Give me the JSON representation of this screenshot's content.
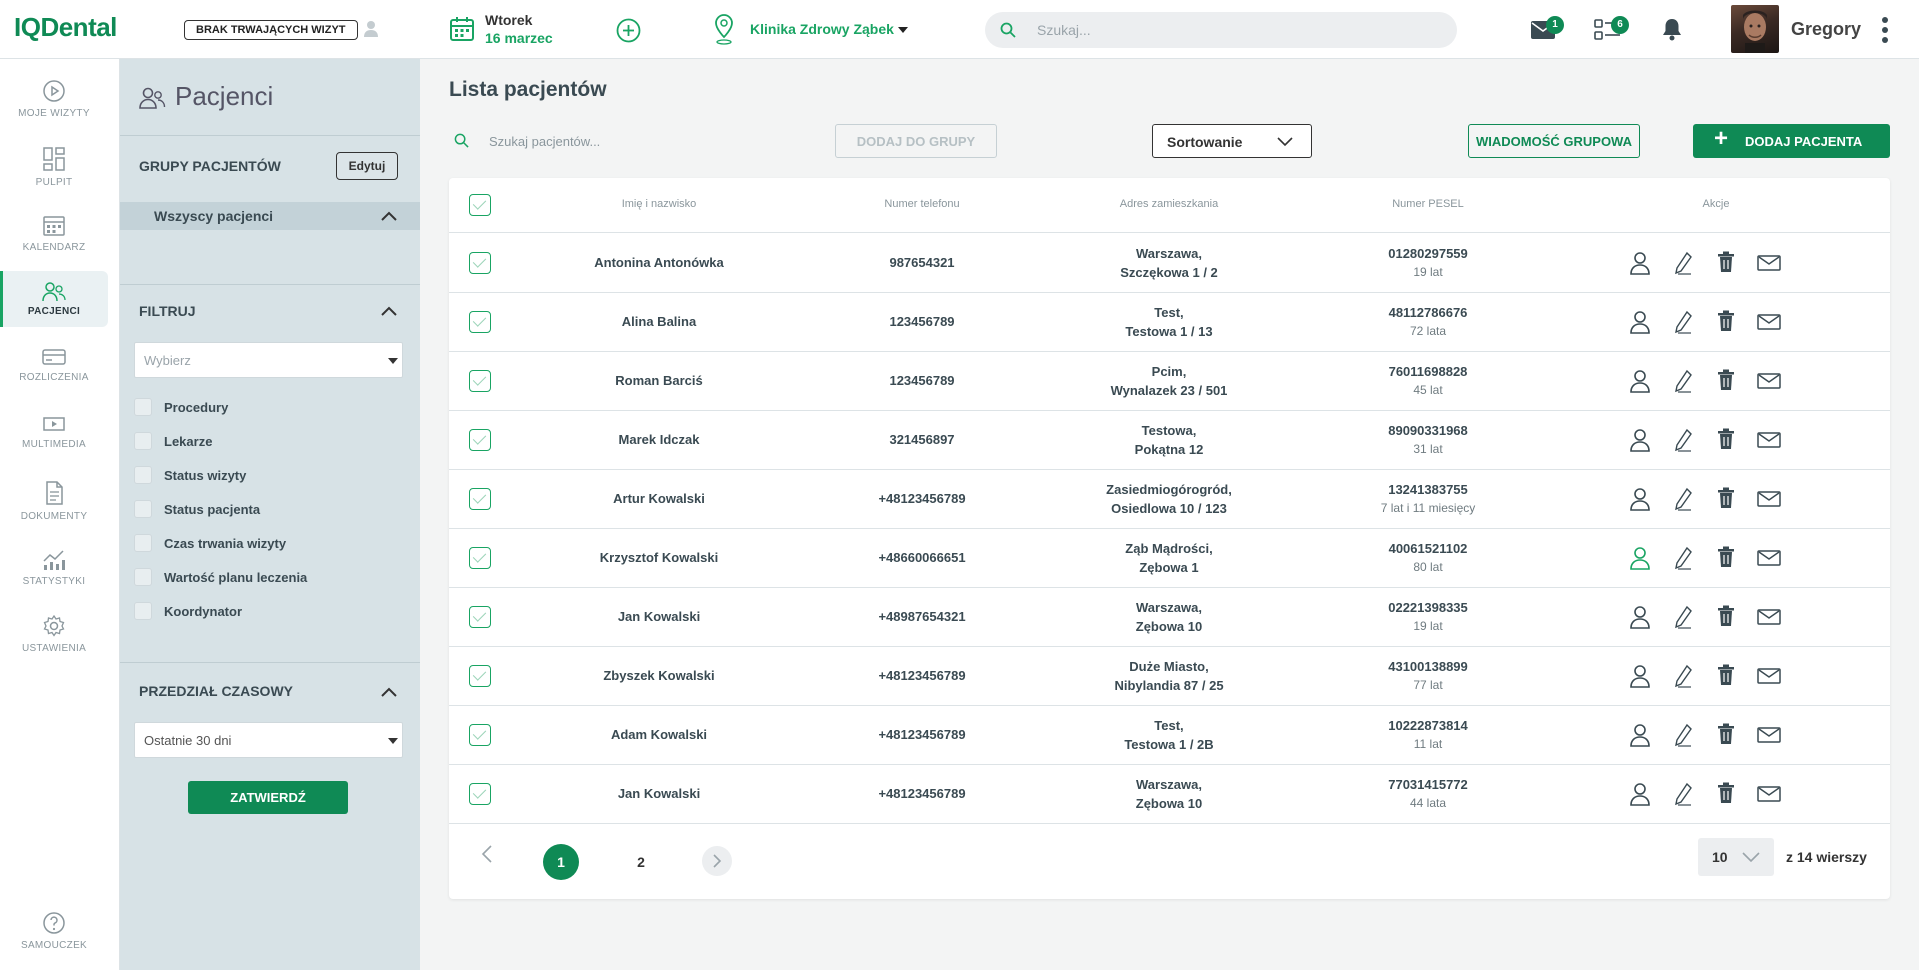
{
  "topbar": {
    "logo": "IQDental",
    "no_visits": "BRAK TRWAJĄCYCH WIZYT",
    "date_day": "Wtorek",
    "date_value": "16 marzec",
    "clinic": "Klinika Zdrowy Ząbek",
    "search_placeholder": "Szukaj...",
    "mail_count": "1",
    "tasks_count": "6",
    "user_name": "Gregory"
  },
  "nav": {
    "items": [
      {
        "label": "MOJE WIZYTY",
        "icon": "play-circle-icon"
      },
      {
        "label": "PULPIT",
        "icon": "dashboard-icon"
      },
      {
        "label": "KALENDARZ",
        "icon": "calendar-icon"
      },
      {
        "label": "PACJENCI",
        "icon": "patients-icon",
        "active": true
      },
      {
        "label": "ROZLICZENIA",
        "icon": "billing-icon"
      },
      {
        "label": "MULTIMEDIA",
        "icon": "multimedia-icon"
      },
      {
        "label": "DOKUMENTY",
        "icon": "documents-icon"
      },
      {
        "label": "STATYSTYKI",
        "icon": "statistics-icon"
      },
      {
        "label": "USTAWIENIA",
        "icon": "settings-icon"
      }
    ],
    "help_label": "SAMOUCZEK"
  },
  "panel": {
    "title": "Pacjenci",
    "groups_title": "GRUPY PACJENTÓW",
    "edit_label": "Edytuj",
    "all_patients": "Wszyscy pacjenci",
    "filter_title": "FILTRUJ",
    "filter_select": "Wybierz",
    "filters": [
      "Procedury",
      "Lekarze",
      "Status wizyty",
      "Status pacjenta",
      "Czas trwania wizyty",
      "Wartość planu leczenia",
      "Koordynator"
    ],
    "time_title": "PRZEDZIAŁ CZASOWY",
    "time_select": "Ostatnie 30 dni",
    "confirm_label": "ZATWIERDŹ"
  },
  "main": {
    "title": "Lista pacjentów",
    "search_placeholder": "Szukaj pacjentów...",
    "add_to_group": "DODAJ DO GRUPY",
    "sort_label": "Sortowanie",
    "group_message": "WIADOMOŚĆ GRUPOWA",
    "add_patient": "DODAJ PACJENTA"
  },
  "table": {
    "columns": [
      "Imię i nazwisko",
      "Numer telefonu",
      "Adres zamieszkania",
      "Numer PESEL",
      "Akcje"
    ],
    "rows": [
      {
        "name": "Antonina Antonówka",
        "phone": "987654321",
        "city": "Warszawa,",
        "street": "Szczękowa 1 / 2",
        "pesel": "01280297559",
        "age": "19 lat"
      },
      {
        "name": "Alina Balina",
        "phone": "123456789",
        "city": "Test,",
        "street": "Testowa 1 / 13",
        "pesel": "48112786676",
        "age": "72 lata"
      },
      {
        "name": "Roman Barciś",
        "phone": "123456789",
        "city": "Pcim,",
        "street": "Wynalazek 23 / 501",
        "pesel": "76011698828",
        "age": "45 lat"
      },
      {
        "name": "Marek Idczak",
        "phone": "321456897",
        "city": "Testowa,",
        "street": "Pokątna 12",
        "pesel": "89090331968",
        "age": "31 lat"
      },
      {
        "name": "Artur Kowalski",
        "phone": "+48123456789",
        "city": "Zasiedmiogórogród,",
        "street": "Osiedlowa 10 / 123",
        "pesel": "13241383755",
        "age": "7 lat i 11 miesięcy"
      },
      {
        "name": "Krzysztof Kowalski",
        "phone": "+48660066651",
        "city": "Ząb Mądrości,",
        "street": "Zębowa 1",
        "pesel": "40061521102",
        "age": "80 lat",
        "highlight": true
      },
      {
        "name": "Jan Kowalski",
        "phone": "+48987654321",
        "city": "Warszawa,",
        "street": "Zębowa 10",
        "pesel": "02221398335",
        "age": "19 lat"
      },
      {
        "name": "Zbyszek Kowalski",
        "phone": "+48123456789",
        "city": "Duże Miasto,",
        "street": "Nibylandia 87 / 25",
        "pesel": "43100138899",
        "age": "77 lat"
      },
      {
        "name": "Adam Kowalski",
        "phone": "+48123456789",
        "city": "Test,",
        "street": "Testowa 1 / 2B",
        "pesel": "10222873814",
        "age": "11 lat"
      },
      {
        "name": "Jan Kowalski",
        "phone": "+48123456789",
        "city": "Warszawa,",
        "street": "Zębowa 10",
        "pesel": "77031415772",
        "age": "44 lata"
      }
    ]
  },
  "pagination": {
    "pages": [
      "1",
      "2"
    ],
    "current": "1",
    "per_page": "10",
    "total_label": "z 14 wierszy"
  },
  "colors": {
    "accent": "#0f8a55",
    "accent_light": "#19a463",
    "panel_bg": "#d7e2e6"
  }
}
